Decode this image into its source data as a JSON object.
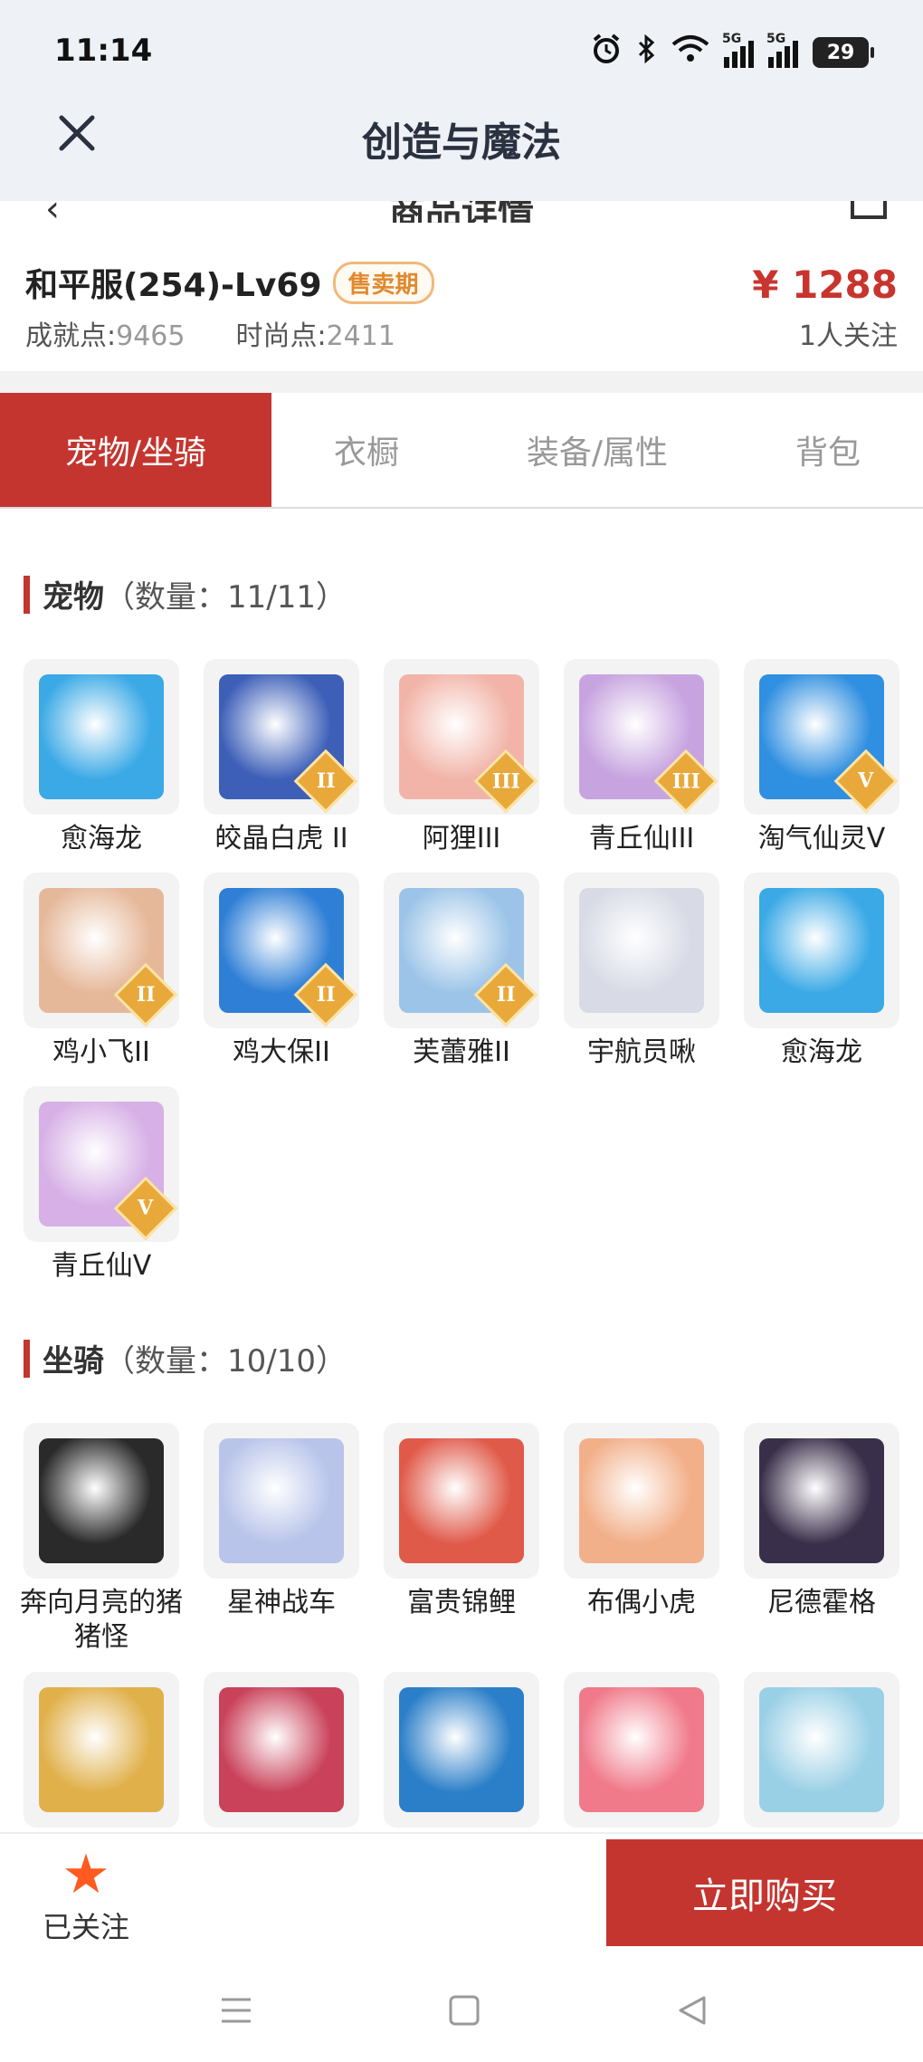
{
  "status_bar": {
    "time": "11:14",
    "battery": "29",
    "signal_label": "5G"
  },
  "app": {
    "title": "创造与魔法"
  },
  "sub_header": {
    "title": "商品详情"
  },
  "product": {
    "server": "和平服(254)-Lv69",
    "badge": "售卖期",
    "achievement_label": "成就点:",
    "achievement_value": "9465",
    "fashion_label": "时尚点:",
    "fashion_value": "2411",
    "price": "¥ 1288",
    "followers": "1人关注"
  },
  "tabs": [
    {
      "label": "宠物/坐骑",
      "active": true
    },
    {
      "label": "衣橱",
      "active": false
    },
    {
      "label": "装备/属性",
      "active": false
    },
    {
      "label": "背包",
      "active": false
    }
  ],
  "pets": {
    "title": "宠物",
    "count": "（数量：11/11）",
    "items": [
      {
        "name": "愈海龙",
        "tier": "",
        "color": "#3aa9e6"
      },
      {
        "name": "皎晶白虎 II",
        "tier": "II",
        "color": "#3d5fb8"
      },
      {
        "name": "阿狸III",
        "tier": "III",
        "color": "#f2b4a8"
      },
      {
        "name": "青丘仙III",
        "tier": "III",
        "color": "#c7a4e0"
      },
      {
        "name": "淘气仙灵V",
        "tier": "V",
        "color": "#2f8fe0"
      },
      {
        "name": "鸡小飞II",
        "tier": "II",
        "color": "#e6b89a"
      },
      {
        "name": "鸡大保II",
        "tier": "II",
        "color": "#2f7fd6"
      },
      {
        "name": "芙蕾雅II",
        "tier": "II",
        "color": "#9cc4e8"
      },
      {
        "name": "宇航员啾",
        "tier": "",
        "color": "#d8dbe6"
      },
      {
        "name": "愈海龙",
        "tier": "",
        "color": "#3aa9e6"
      },
      {
        "name": "青丘仙V",
        "tier": "V",
        "color": "#d6b0e6"
      }
    ]
  },
  "mounts": {
    "title": "坐骑",
    "count": "（数量：10/10）",
    "items": [
      {
        "name": "奔向月亮的猪猪怪",
        "color": "#2a2a2a"
      },
      {
        "name": "星神战车",
        "color": "#b8c4ea"
      },
      {
        "name": "富贵锦鲤",
        "color": "#e05a4a"
      },
      {
        "name": "布偶小虎",
        "color": "#f2b08a"
      },
      {
        "name": "尼德霍格",
        "color": "#3a2f4a"
      },
      {
        "name": "",
        "color": "#e0b04a"
      },
      {
        "name": "",
        "color": "#c9425a"
      },
      {
        "name": "",
        "color": "#2b7fc8"
      },
      {
        "name": "",
        "color": "#f07a8a"
      },
      {
        "name": "",
        "color": "#9ad0e6"
      }
    ]
  },
  "bottom": {
    "follow_label": "已关注",
    "buy_label": "立即购买"
  },
  "colors": {
    "accent": "#c4352f",
    "price": "#c8352e",
    "badge": "#e08a2e",
    "star": "#ff5a1f"
  }
}
